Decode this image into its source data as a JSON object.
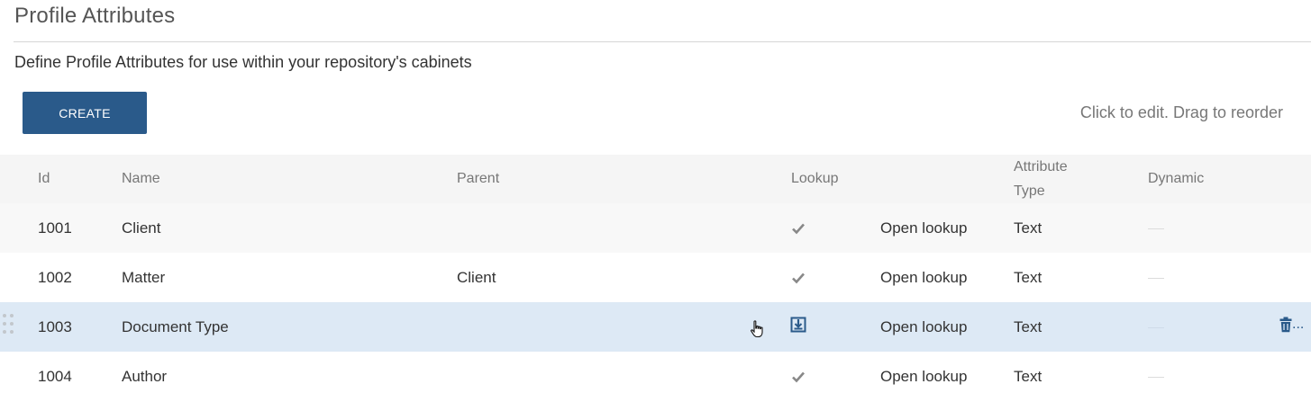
{
  "page": {
    "title": "Profile Attributes",
    "description": "Define Profile Attributes for use within your repository's cabinets",
    "create_label": "CREATE",
    "hint": "Click to edit. Drag to reorder"
  },
  "table": {
    "headers": {
      "id": "Id",
      "name": "Name",
      "parent": "Parent",
      "lookup": "Lookup",
      "attribute_type_line1": "Attribute",
      "attribute_type_line2": "Type",
      "dynamic": "Dynamic"
    },
    "rows": [
      {
        "id": "1001",
        "name": "Client",
        "parent": "",
        "lookup": "checked",
        "open_lookup": "Open lookup",
        "type": "Text",
        "dynamic": "none"
      },
      {
        "id": "1002",
        "name": "Matter",
        "parent": "Client",
        "lookup": "checked",
        "open_lookup": "Open lookup",
        "type": "Text",
        "dynamic": "none"
      },
      {
        "id": "1003",
        "name": "Document Type",
        "parent": "",
        "lookup": "edit",
        "open_lookup": "Open lookup",
        "type": "Text",
        "dynamic": "none"
      },
      {
        "id": "1004",
        "name": "Author",
        "parent": "",
        "lookup": "checked",
        "open_lookup": "Open lookup",
        "type": "Text",
        "dynamic": "none"
      }
    ]
  },
  "hovered_row_actions": {
    "more_label": "..."
  },
  "colors": {
    "accent": "#2a5a8a",
    "header_bg": "#f5f5f5",
    "row_highlight": "#dde9f5"
  },
  "icons": [
    "check-icon",
    "lookup-edit-icon",
    "trash-icon",
    "drag-handle-icon",
    "pointer-cursor-icon"
  ]
}
